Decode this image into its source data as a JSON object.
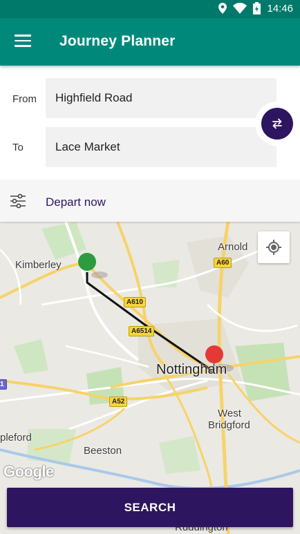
{
  "status_bar": {
    "time": "14:46",
    "icons": [
      "location-icon",
      "wifi-icon",
      "battery-charging-icon"
    ]
  },
  "app_bar": {
    "title": "Journey Planner",
    "menu_icon": "hamburger-menu-icon"
  },
  "form": {
    "from_label": "From",
    "from_value": "Highfield Road",
    "to_label": "To",
    "to_value": "Lace Market",
    "swap_icon": "swap-direction-icon"
  },
  "depart": {
    "label": "Depart now",
    "icon": "sliders-icon"
  },
  "map": {
    "places": {
      "kimberley": "Kimberley",
      "arnold": "Arnold",
      "nottingham": "Nottingham",
      "west_bridgford_line1": "West",
      "west_bridgford_line2": "Bridgford",
      "beeston": "Beeston",
      "stapleford": "pleford",
      "ruddington": "Ruddington"
    },
    "roads": {
      "a60": "A60",
      "a610": "A610",
      "a6514": "A6514",
      "a52": "A52",
      "edge": "1"
    },
    "attribution": "Google",
    "start_marker_color": "#2e9b3f",
    "end_marker_color": "#e53935",
    "locate_icon": "my-location-icon"
  },
  "search_button": {
    "label": "SEARCH"
  },
  "colors": {
    "primary": "#00897b",
    "status": "#00796b",
    "accent": "#2e1560"
  }
}
